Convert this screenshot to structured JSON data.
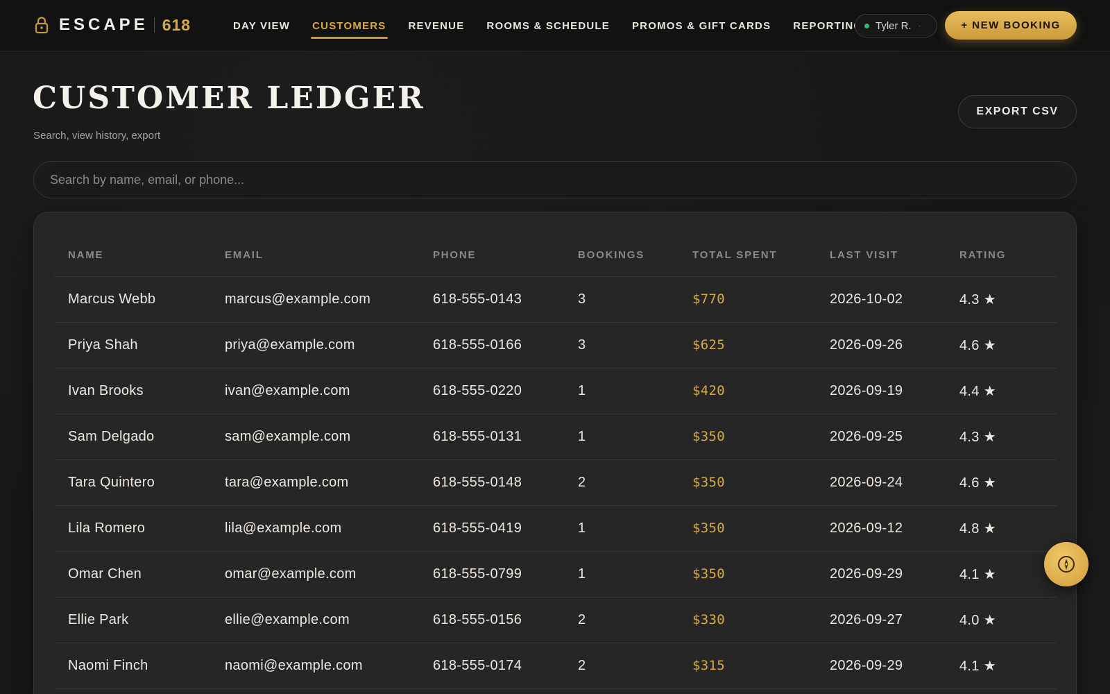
{
  "brand": {
    "word": "ESCAPE",
    "number": "618"
  },
  "nav": {
    "items": [
      {
        "label": "DAY VIEW"
      },
      {
        "label": "CUSTOMERS"
      },
      {
        "label": "REVENUE"
      },
      {
        "label": "ROOMS & SCHEDULE"
      },
      {
        "label": "PROMOS & GIFT CARDS"
      },
      {
        "label": "REPORTING"
      }
    ],
    "active": "CUSTOMERS"
  },
  "user": {
    "name": "Tyler R.",
    "caret": "·"
  },
  "header": {
    "new_booking_label": "+ NEW BOOKING"
  },
  "page": {
    "title": "CUSTOMER LEDGER",
    "subtitle": "Search, view history, export",
    "export_label": "EXPORT CSV"
  },
  "search": {
    "placeholder": "Search by name, email, or phone...",
    "value": ""
  },
  "table": {
    "columns": [
      "NAME",
      "EMAIL",
      "PHONE",
      "BOOKINGS",
      "TOTAL SPENT",
      "LAST VISIT",
      "RATING"
    ],
    "rows": [
      {
        "name": "Marcus Webb",
        "email": "marcus@example.com",
        "phone": "618-555-0143",
        "bookings": "3",
        "spent": "$770",
        "last_visit": "2026-10-02",
        "rating": "4.3"
      },
      {
        "name": "Priya Shah",
        "email": "priya@example.com",
        "phone": "618-555-0166",
        "bookings": "3",
        "spent": "$625",
        "last_visit": "2026-09-26",
        "rating": "4.6"
      },
      {
        "name": "Ivan Brooks",
        "email": "ivan@example.com",
        "phone": "618-555-0220",
        "bookings": "1",
        "spent": "$420",
        "last_visit": "2026-09-19",
        "rating": "4.4"
      },
      {
        "name": "Sam Delgado",
        "email": "sam@example.com",
        "phone": "618-555-0131",
        "bookings": "1",
        "spent": "$350",
        "last_visit": "2026-09-25",
        "rating": "4.3"
      },
      {
        "name": "Tara Quintero",
        "email": "tara@example.com",
        "phone": "618-555-0148",
        "bookings": "2",
        "spent": "$350",
        "last_visit": "2026-09-24",
        "rating": "4.6"
      },
      {
        "name": "Lila Romero",
        "email": "lila@example.com",
        "phone": "618-555-0419",
        "bookings": "1",
        "spent": "$350",
        "last_visit": "2026-09-12",
        "rating": "4.8"
      },
      {
        "name": "Omar Chen",
        "email": "omar@example.com",
        "phone": "618-555-0799",
        "bookings": "1",
        "spent": "$350",
        "last_visit": "2026-09-29",
        "rating": "4.1"
      },
      {
        "name": "Ellie Park",
        "email": "ellie@example.com",
        "phone": "618-555-0156",
        "bookings": "2",
        "spent": "$330",
        "last_visit": "2026-09-27",
        "rating": "4.0"
      },
      {
        "name": "Naomi Finch",
        "email": "naomi@example.com",
        "phone": "618-555-0174",
        "bookings": "2",
        "spent": "$315",
        "last_visit": "2026-09-29",
        "rating": "4.1"
      }
    ],
    "rating_icon": "star-icon"
  },
  "fab": {
    "icon": "compass-icon"
  },
  "colors": {
    "accent": "#d9a946",
    "background": "#171717",
    "card": "#262626",
    "status_online": "#3cb371"
  }
}
